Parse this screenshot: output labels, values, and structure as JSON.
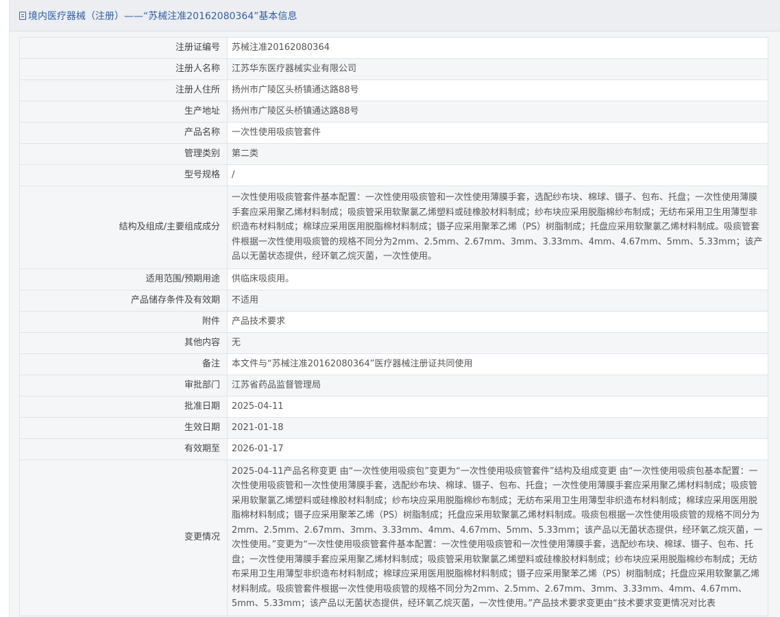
{
  "header": {
    "icon": "document-icon",
    "title": "境内医疗器械（注册）——“苏械注准20162080364”基本信息"
  },
  "rows": [
    {
      "label": "注册证编号",
      "value": "苏械注准20162080364"
    },
    {
      "label": "注册人名称",
      "value": "江苏华东医疗器械实业有限公司"
    },
    {
      "label": "注册人住所",
      "value": "扬州市广陵区头桥镇通达路88号"
    },
    {
      "label": "生产地址",
      "value": "扬州市广陵区头桥镇通达路88号"
    },
    {
      "label": "产品名称",
      "value": "一次性使用吸痰管套件"
    },
    {
      "label": "管理类别",
      "value": "第二类"
    },
    {
      "label": "型号规格",
      "value": "/"
    },
    {
      "label": "结构及组成/主要组成成分",
      "value": "一次性使用吸痰管套件基本配置：一次性使用吸痰管和一次性使用薄膜手套，选配纱布块、棉球、镊子、包布、托盘；一次性使用薄膜手套应采用聚乙烯材料制成；吸痰管采用软聚氯乙烯塑料或硅橡胶材料制成；纱布块应采用脱脂棉纱布制成；无纺布采用卫生用薄型非织造布材料制成；棉球应采用医用脱脂棉材料制成；镊子应采用聚苯乙烯（PS）树脂制成；托盘应采用软聚氯乙烯材料制成。吸痰管套件根据一次性使用吸痰管的规格不同分为2mm、2.5mm、2.67mm、3mm、3.33mm、4mm、4.67mm、5mm、5.33mm；该产品以无菌状态提供，经环氧乙烷灭菌，一次性使用。"
    },
    {
      "label": "适用范围/预期用途",
      "value": "供临床吸痰用。"
    },
    {
      "label": "产品储存条件及有效期",
      "value": "不适用"
    },
    {
      "label": "附件",
      "value": "产品技术要求"
    },
    {
      "label": "其他内容",
      "value": "无"
    },
    {
      "label": "备注",
      "value": "本文件与“苏械注准20162080364”医疗器械注册证共同使用"
    },
    {
      "label": "审批部门",
      "value": "江苏省药品监督管理局"
    },
    {
      "label": "批准日期",
      "value": "2025-04-11"
    },
    {
      "label": "生效日期",
      "value": "2021-01-18"
    },
    {
      "label": "有效期至",
      "value": "2026-01-17"
    },
    {
      "label": "变更情况",
      "value": "2025-04-11产品名称变更 由“一次性使用吸痰包”变更为“一次性使用吸痰管套件”结构及组成变更 由“一次性使用吸痰包基本配置：一次性使用吸痰管和一次性使用薄膜手套，选配纱布块、棉球、镊子、包布、托盘；一次性使用薄膜手套应采用聚乙烯材料制成；吸痰管采用软聚氯乙烯塑料或硅橡胶材料制成；纱布块应采用脱脂棉纱布制成；无纺布采用卫生用薄型非织造布材料制成；棉球应采用医用脱脂棉材料制成；镊子应采用聚苯乙烯（PS）树脂制成；托盘应采用软聚氯乙烯材料制成。吸痰包根据一次性使用吸痰管的规格不同分为2mm、2.5mm、2.67mm、3mm、3.33mm、4mm、4.67mm、5mm、5.33mm；该产品以无菌状态提供，经环氧乙烷灭菌，一次性使用。”变更为“一次性使用吸痰管套件基本配置：一次性使用吸痰管和一次性使用薄膜手套，选配纱布块、棉球、镊子、包布、托盘；一次性使用薄膜手套应采用聚乙烯材料制成；吸痰管采用软聚氯乙烯塑料或硅橡胶材料制成；纱布块应采用脱脂棉纱布制成；无纺布采用卫生用薄型非织造布材料制成；棉球应采用医用脱脂棉材料制成；镊子应采用聚苯乙烯（PS）树脂制成；托盘应采用软聚氯乙烯材料制成。吸痰管套件根据一次性使用吸痰管的规格不同分为2mm、2.5mm、2.67mm、3mm、3.33mm、4mm、4.67mm、5mm、5.33mm；该产品以无菌状态提供，经环氧乙烷灭菌，一次性使用。”产品技术要求变更由“技术要求变更情况对比表"
    }
  ]
}
